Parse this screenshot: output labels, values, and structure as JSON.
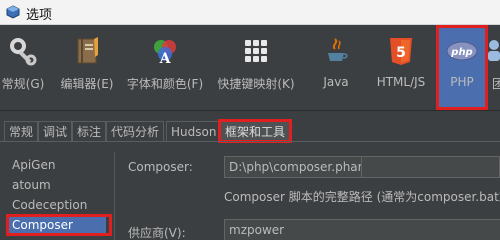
{
  "window": {
    "title": "选项"
  },
  "toolbar": [
    {
      "label": "常规(G)",
      "icon": "wrench-gear-icon"
    },
    {
      "label": "编辑器(E)",
      "icon": "notebook-icon"
    },
    {
      "label": "字体和颜色(F)",
      "icon": "font-colors-icon"
    },
    {
      "label": "快捷键映射(K)",
      "icon": "keyboard-icon"
    },
    {
      "label": "Java",
      "icon": "java-icon"
    },
    {
      "label": "HTML/JS",
      "icon": "html5-icon"
    },
    {
      "label": "PHP",
      "icon": "php-icon",
      "selected": true
    },
    {
      "label": "团",
      "icon": "team-icon"
    }
  ],
  "tabs": [
    "常规",
    "调试",
    "标注",
    "代码分析",
    "Hudson",
    "框架和工具"
  ],
  "active_tab": "框架和工具",
  "frameworks": [
    "ApiGen",
    "atoum",
    "Codeception",
    "Composer"
  ],
  "selected_framework": "Composer",
  "composer": {
    "path_label": "Composer:",
    "path_value": "D:\\php\\composer.phar",
    "hint": "Composer 脚本的完整路径 (通常为composer.bat或",
    "vendor_label": "供应商(V):",
    "vendor_value": "mzpower"
  },
  "colors": {
    "background": "#3c3f41",
    "selection": "#4b6eaf",
    "highlight_box": "#e02020"
  }
}
